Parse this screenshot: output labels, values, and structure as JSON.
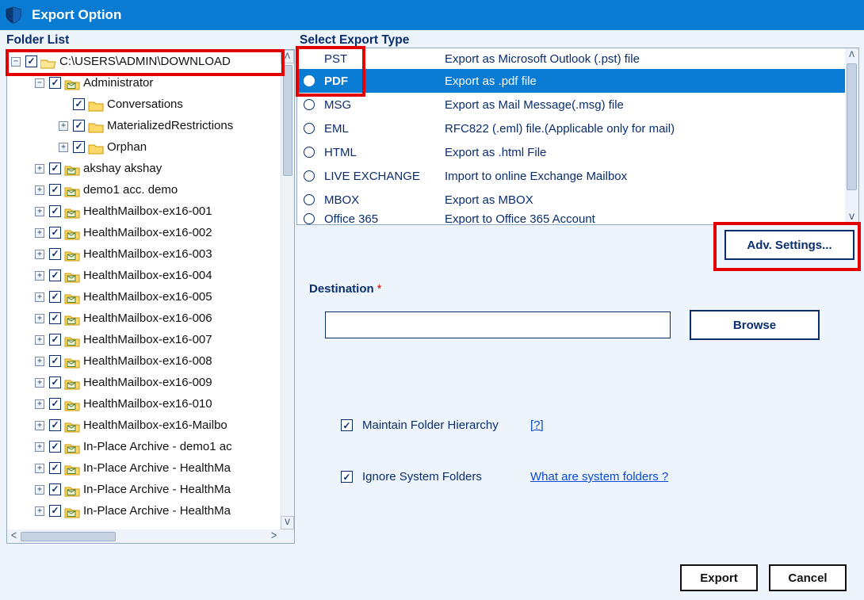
{
  "title": "Export Option",
  "folder_heading": "Folder List",
  "folder_tree": [
    {
      "indent": 0,
      "exp": "-",
      "checked": true,
      "icon": "folder-open",
      "label": "C:\\USERS\\ADMIN\\DOWNLOAD"
    },
    {
      "indent": 1,
      "exp": "-",
      "checked": true,
      "icon": "mailbox",
      "label": "Administrator"
    },
    {
      "indent": 2,
      "exp": "",
      "checked": true,
      "icon": "folder",
      "label": "Conversations"
    },
    {
      "indent": 2,
      "exp": "+",
      "checked": true,
      "icon": "folder",
      "label": "MaterializedRestrictions"
    },
    {
      "indent": 2,
      "exp": "+",
      "checked": true,
      "icon": "folder",
      "label": "Orphan"
    },
    {
      "indent": 1,
      "exp": "+",
      "checked": true,
      "icon": "mailbox",
      "label": "akshay akshay"
    },
    {
      "indent": 1,
      "exp": "+",
      "checked": true,
      "icon": "mailbox",
      "label": "demo1 acc. demo"
    },
    {
      "indent": 1,
      "exp": "+",
      "checked": true,
      "icon": "mailbox",
      "label": "HealthMailbox-ex16-001"
    },
    {
      "indent": 1,
      "exp": "+",
      "checked": true,
      "icon": "mailbox",
      "label": "HealthMailbox-ex16-002"
    },
    {
      "indent": 1,
      "exp": "+",
      "checked": true,
      "icon": "mailbox",
      "label": "HealthMailbox-ex16-003"
    },
    {
      "indent": 1,
      "exp": "+",
      "checked": true,
      "icon": "mailbox",
      "label": "HealthMailbox-ex16-004"
    },
    {
      "indent": 1,
      "exp": "+",
      "checked": true,
      "icon": "mailbox",
      "label": "HealthMailbox-ex16-005"
    },
    {
      "indent": 1,
      "exp": "+",
      "checked": true,
      "icon": "mailbox",
      "label": "HealthMailbox-ex16-006"
    },
    {
      "indent": 1,
      "exp": "+",
      "checked": true,
      "icon": "mailbox",
      "label": "HealthMailbox-ex16-007"
    },
    {
      "indent": 1,
      "exp": "+",
      "checked": true,
      "icon": "mailbox",
      "label": "HealthMailbox-ex16-008"
    },
    {
      "indent": 1,
      "exp": "+",
      "checked": true,
      "icon": "mailbox",
      "label": "HealthMailbox-ex16-009"
    },
    {
      "indent": 1,
      "exp": "+",
      "checked": true,
      "icon": "mailbox",
      "label": "HealthMailbox-ex16-010"
    },
    {
      "indent": 1,
      "exp": "+",
      "checked": true,
      "icon": "mailbox",
      "label": "HealthMailbox-ex16-Mailbo"
    },
    {
      "indent": 1,
      "exp": "+",
      "checked": true,
      "icon": "mailbox",
      "label": "In-Place Archive - demo1 ac"
    },
    {
      "indent": 1,
      "exp": "+",
      "checked": true,
      "icon": "mailbox",
      "label": "In-Place Archive - HealthMa"
    },
    {
      "indent": 1,
      "exp": "+",
      "checked": true,
      "icon": "mailbox",
      "label": "In-Place Archive - HealthMa"
    },
    {
      "indent": 1,
      "exp": "+",
      "checked": true,
      "icon": "mailbox",
      "label": "In-Place Archive - HealthMa"
    }
  ],
  "export_heading": "Select Export Type",
  "export_types": [
    {
      "name": "PST",
      "desc": "Export as Microsoft Outlook (.pst) file",
      "selected": false,
      "clip": "top"
    },
    {
      "name": "PDF",
      "desc": "Export as .pdf file",
      "selected": true
    },
    {
      "name": "MSG",
      "desc": "Export as Mail Message(.msg) file",
      "selected": false
    },
    {
      "name": "EML",
      "desc": "RFC822 (.eml) file.(Applicable only for mail)",
      "selected": false
    },
    {
      "name": "HTML",
      "desc": "Export as .html File",
      "selected": false
    },
    {
      "name": "LIVE EXCHANGE",
      "desc": "Import to online Exchange Mailbox",
      "selected": false
    },
    {
      "name": "MBOX",
      "desc": "Export as MBOX",
      "selected": false
    },
    {
      "name": "Office 365",
      "desc": "Export to Office 365 Account",
      "selected": false,
      "clip": "bottom"
    }
  ],
  "adv_settings_label": "Adv. Settings...",
  "destination_label": "Destination",
  "destination_value": "",
  "browse_label": "Browse",
  "opt_maintain": "Maintain Folder Hierarchy",
  "opt_maintain_link": "[?]",
  "opt_ignore": "Ignore System Folders",
  "opt_ignore_link": "What are system folders ?",
  "export_label": "Export",
  "cancel_label": "Cancel"
}
